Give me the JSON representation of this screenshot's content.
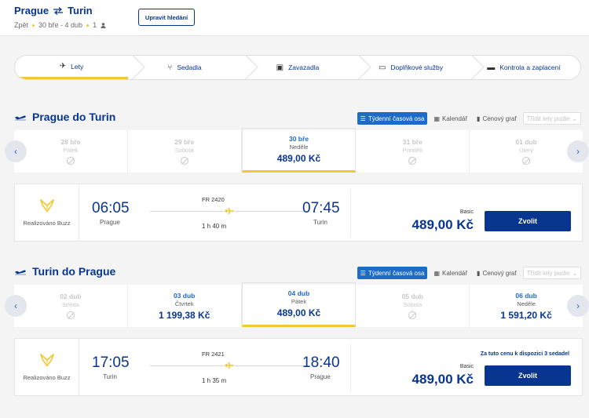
{
  "header": {
    "origin": "Prague",
    "destination": "Turin",
    "trip_type": "Zpět",
    "dates": "30 bře - 4 dub",
    "passengers": "1",
    "edit_label": "Upravit hledání"
  },
  "steps": [
    {
      "label": "Lety",
      "icon": "plane-icon",
      "active": true
    },
    {
      "label": "Sedadla",
      "icon": "seat-icon",
      "active": false
    },
    {
      "label": "Zavazadla",
      "icon": "luggage-icon",
      "active": false
    },
    {
      "label": "Doplňkové služby",
      "icon": "monitor-icon",
      "active": false
    },
    {
      "label": "Kontrola a zaplacení",
      "icon": "card-icon",
      "active": false
    }
  ],
  "view_tabs": {
    "weekly": "Týdenní časová osa",
    "calendar": "Kalendář",
    "price_chart": "Cenový graf",
    "sort": "Třídit lety podle"
  },
  "outbound": {
    "title": "Prague do Turin",
    "dates": [
      {
        "date": "28 bře",
        "day": "Pátek",
        "price": null,
        "available": false,
        "selected": false
      },
      {
        "date": "29 bře",
        "day": "Sobota",
        "price": null,
        "available": false,
        "selected": false
      },
      {
        "date": "30 bře",
        "day": "Neděle",
        "price": "489,00 Kč",
        "available": true,
        "selected": true
      },
      {
        "date": "31 bře",
        "day": "Pondělí",
        "price": null,
        "available": false,
        "selected": false
      },
      {
        "date": "01 dub",
        "day": "Úterý",
        "price": null,
        "available": false,
        "selected": false
      }
    ],
    "flight": {
      "carrier": "Realizováno Buzz",
      "dep_time": "06:05",
      "dep_city": "Prague",
      "arr_time": "07:45",
      "arr_city": "Turin",
      "flight_no": "FR 2420",
      "duration": "1 h 40 m",
      "fare_label": "Basic",
      "price": "489,00 Kč",
      "seats_note": "",
      "button": "Zvolit"
    }
  },
  "inbound": {
    "title": "Turin do Prague",
    "dates": [
      {
        "date": "02 dub",
        "day": "Středa",
        "price": null,
        "available": false,
        "selected": false
      },
      {
        "date": "03 dub",
        "day": "Čtvrtek",
        "price": "1 199,38 Kč",
        "available": true,
        "selected": false
      },
      {
        "date": "04 dub",
        "day": "Pátek",
        "price": "489,00 Kč",
        "available": true,
        "selected": true
      },
      {
        "date": "05 dub",
        "day": "Sobota",
        "price": null,
        "available": false,
        "selected": false
      },
      {
        "date": "06 dub",
        "day": "Neděle",
        "price": "1 591,20 Kč",
        "available": true,
        "selected": false
      }
    ],
    "flight": {
      "carrier": "Realizováno Buzz",
      "dep_time": "17:05",
      "dep_city": "Turin",
      "arr_time": "18:40",
      "arr_city": "Prague",
      "flight_no": "FR 2421",
      "duration": "1 h 35 m",
      "fare_label": "Basic",
      "price": "489,00 Kč",
      "seats_note": "Za tuto cenu k dispozici 3 sedadel",
      "button": "Zvolit"
    }
  },
  "colors": {
    "brand": "#073590",
    "accent": "#f1c933",
    "active_tab": "#1c6bc7"
  }
}
